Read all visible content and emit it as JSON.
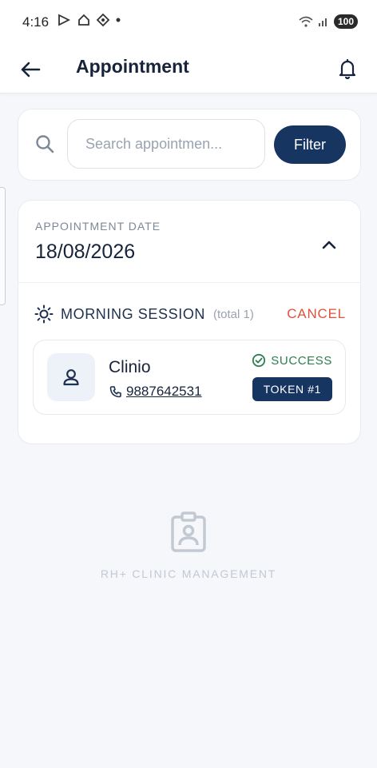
{
  "status_bar": {
    "time": "4:16",
    "battery": "100"
  },
  "app_bar": {
    "title": "Appointment"
  },
  "search": {
    "placeholder": "Search appointmen...",
    "value": "",
    "filter_label": "Filter"
  },
  "appointment_date": {
    "label": "APPOINTMENT DATE",
    "value": "18/08/2026",
    "expanded": true
  },
  "session": {
    "title": "MORNING SESSION",
    "total": "(total 1)",
    "cancel_label": "CANCEL",
    "appointments": [
      {
        "name": "Clinio",
        "phone": "9887642531",
        "status": "SUCCESS",
        "token": "TOKEN #1"
      }
    ]
  },
  "footer": {
    "brand": "RH+ CLINIC MANAGEMENT"
  },
  "colors": {
    "primary": "#173561",
    "cancel": "#e0513f",
    "success": "#2e7d4f",
    "background": "#f5f7fb"
  },
  "icons": [
    "back-arrow-icon",
    "bell-icon",
    "search-icon",
    "chevron-up-icon",
    "sun-icon",
    "user-icon",
    "phone-icon",
    "check-circle-icon",
    "badge-id-icon"
  ]
}
